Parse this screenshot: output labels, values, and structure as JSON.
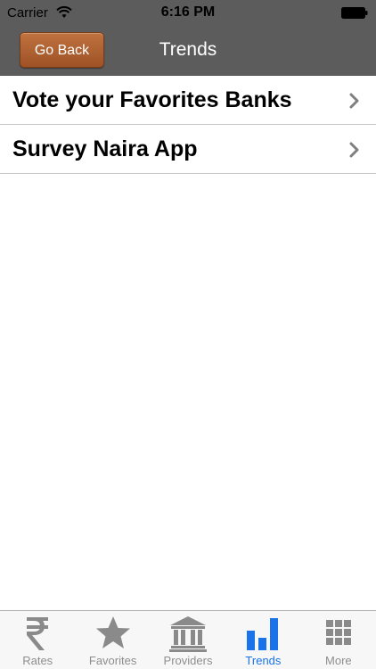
{
  "status_bar": {
    "carrier": "Carrier",
    "time": "6:16 PM"
  },
  "nav": {
    "back_label": "Go Back",
    "title": "Trends"
  },
  "list": {
    "items": [
      {
        "label": "Vote your Favorites Banks"
      },
      {
        "label": "Survey Naira App"
      }
    ]
  },
  "tabs": [
    {
      "label": "Rates",
      "icon": "rupee-icon",
      "active": false
    },
    {
      "label": "Favorites",
      "icon": "star-icon",
      "active": false
    },
    {
      "label": "Providers",
      "icon": "bank-icon",
      "active": false
    },
    {
      "label": "Trends",
      "icon": "bar-chart-icon",
      "active": true
    },
    {
      "label": "More",
      "icon": "grid-icon",
      "active": false
    }
  ],
  "colors": {
    "bar_background": "#5c5c5c",
    "back_button": "#b0622f",
    "tab_active": "#1a73e8",
    "tab_inactive": "#8e8e8e"
  }
}
